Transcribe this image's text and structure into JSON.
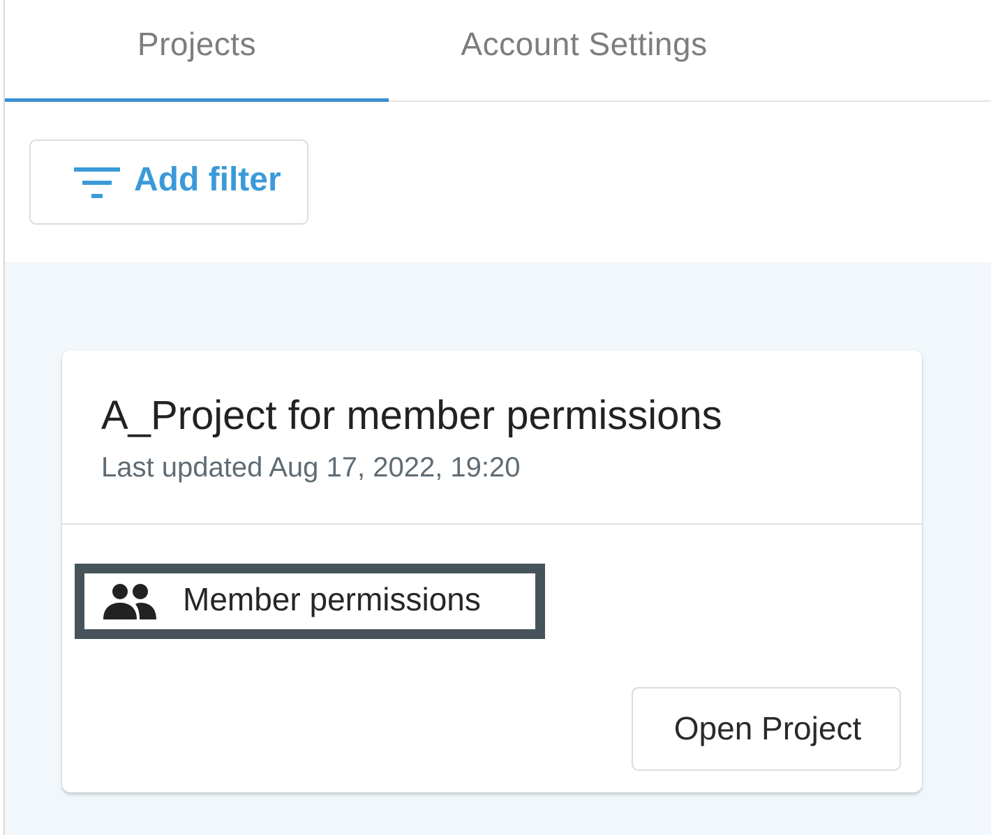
{
  "tabs": [
    {
      "label": "Projects",
      "active": true
    },
    {
      "label": "Account Settings",
      "active": false
    }
  ],
  "filter": {
    "label": "Add filter",
    "icon": "filter-list-icon"
  },
  "project_card": {
    "title": "A_Project for member permissions",
    "last_updated": "Last updated Aug 17, 2022, 19:20",
    "permission": {
      "icon": "people-icon",
      "label": "Member permissions"
    },
    "open_button": "Open Project"
  },
  "colors": {
    "accent": "#3a8fd2",
    "filter_text": "#3a9ad9",
    "content_background": "#f1f7fb",
    "highlight_border": "#46535a"
  }
}
